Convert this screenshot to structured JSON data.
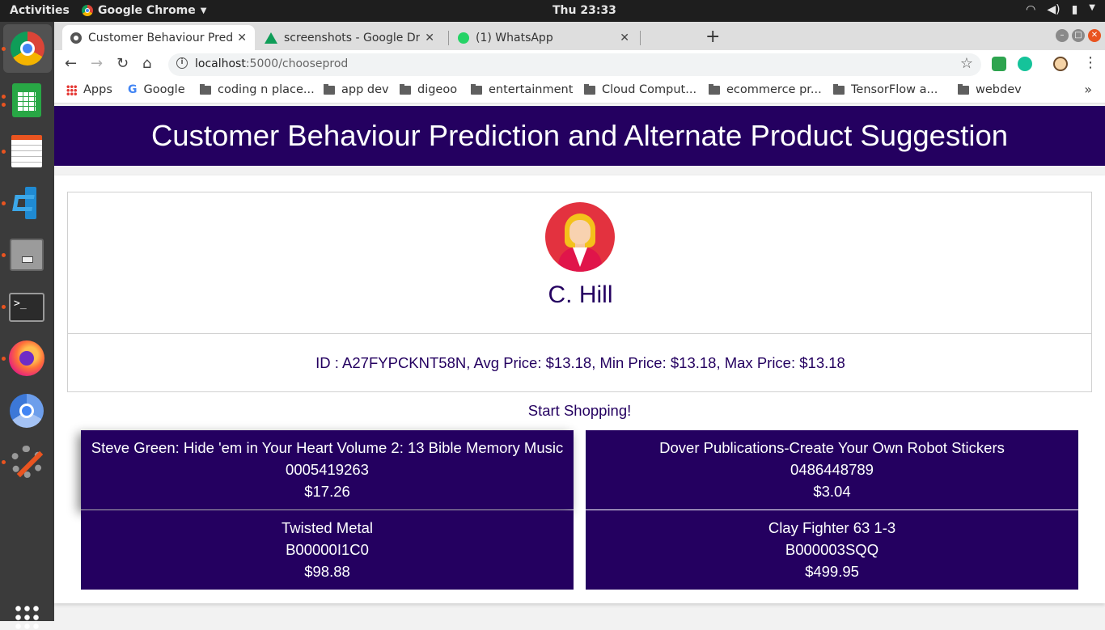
{
  "system": {
    "activities": "Activities",
    "app_menu": "Google Chrome",
    "clock": "Thu 23:33"
  },
  "browser": {
    "tabs": [
      {
        "title": "Customer Behaviour Prediction and Alternate Product Suggestion",
        "active": true
      },
      {
        "title": "screenshots - Google Drive",
        "active": false
      },
      {
        "title": "(1) WhatsApp",
        "active": false
      }
    ],
    "url_host": "localhost",
    "url_path": ":5000/chooseprod",
    "bookmarks": [
      "Apps",
      "Google",
      "coding n place...",
      "app dev",
      "digeoo",
      "entertainment",
      "Cloud Comput...",
      "ecommerce pr...",
      "TensorFlow a...",
      "webdev"
    ]
  },
  "page": {
    "header": "Customer Behaviour Prediction and Alternate Product Suggestion",
    "customer": {
      "name": "C. Hill",
      "stats": "ID : A27FYPCKNT58N, Avg Price: $13.18, Min Price: $13.18, Max Price: $13.18"
    },
    "start_label": "Start Shopping!",
    "products": [
      {
        "title": "Steve Green: Hide 'em in Your Heart Volume 2: 13 Bible Memory Music",
        "id": "0005419263",
        "price": "$17.26"
      },
      {
        "title": "Dover Publications-Create Your Own Robot Stickers",
        "id": "0486448789",
        "price": "$3.04"
      },
      {
        "title": "Twisted Metal",
        "id": "B00000I1C0",
        "price": "$98.88"
      },
      {
        "title": "Clay Fighter 63 1-3",
        "id": "B000003SQQ",
        "price": "$499.95"
      }
    ]
  },
  "colors": {
    "brand": "#240060",
    "ubuntu_accent": "#e95420"
  }
}
